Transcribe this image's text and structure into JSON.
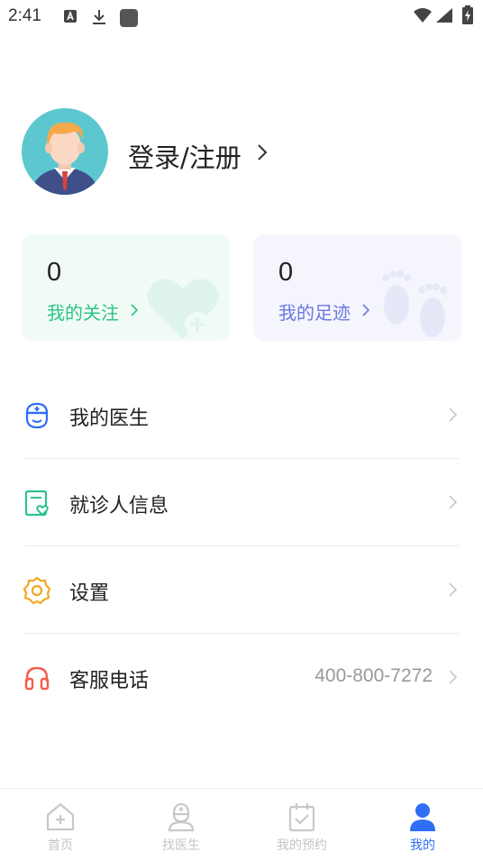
{
  "status_bar": {
    "time": "2:41"
  },
  "profile": {
    "login_text": "登录/注册"
  },
  "stats": [
    {
      "count": "0",
      "label": "我的关注",
      "color": "#2ec28a"
    },
    {
      "count": "0",
      "label": "我的足迹",
      "color": "#6b78e0"
    }
  ],
  "menu": [
    {
      "label": "我的医生",
      "icon": "doctor-icon"
    },
    {
      "label": "就诊人信息",
      "icon": "patient-info-icon"
    },
    {
      "label": "设置",
      "icon": "gear-icon"
    },
    {
      "label": "客服电话",
      "icon": "headset-icon",
      "value": "400-800-7272"
    }
  ],
  "tabs": [
    {
      "label": "首页",
      "icon": "home-icon"
    },
    {
      "label": "找医生",
      "icon": "find-doctor-icon"
    },
    {
      "label": "我的预约",
      "icon": "appointment-icon"
    },
    {
      "label": "我的",
      "icon": "user-icon",
      "active": true
    }
  ],
  "colors": {
    "accent": "#2f6ef5",
    "green": "#2ec28a",
    "purple": "#6b78e0",
    "orange": "#f5a623",
    "red": "#f25d4a"
  }
}
